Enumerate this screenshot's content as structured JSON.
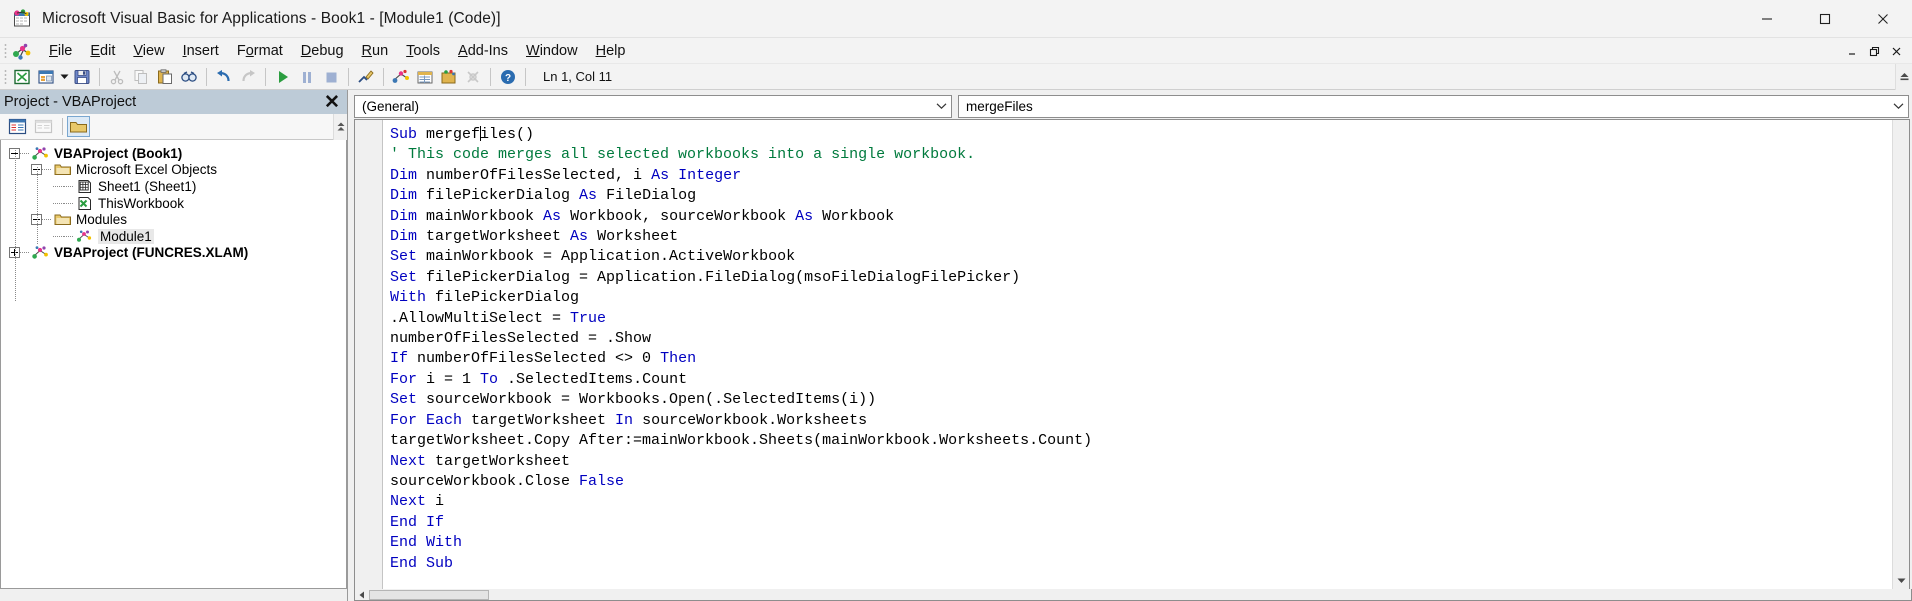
{
  "window": {
    "title": "Microsoft Visual Basic for Applications - Book1 - [Module1 (Code)]",
    "app_icon": "vba-excel-icon",
    "minimize": "—",
    "maximize": "☐",
    "close": "✕"
  },
  "mdi": {
    "minimize": "–",
    "restore": "❐",
    "close": "✕"
  },
  "menu": {
    "items": [
      {
        "label": "File",
        "accel": "F"
      },
      {
        "label": "Edit",
        "accel": "E"
      },
      {
        "label": "View",
        "accel": "V"
      },
      {
        "label": "Insert",
        "accel": "I"
      },
      {
        "label": "Format",
        "accel": "o"
      },
      {
        "label": "Debug",
        "accel": "D"
      },
      {
        "label": "Run",
        "accel": "R"
      },
      {
        "label": "Tools",
        "accel": "T"
      },
      {
        "label": "Add-Ins",
        "accel": "A"
      },
      {
        "label": "Window",
        "accel": "W"
      },
      {
        "label": "Help",
        "accel": "H"
      }
    ]
  },
  "toolbar": {
    "buttons": [
      "view-excel-icon",
      "insert-userform-icon",
      "insert-dropdown-arrow",
      "save-icon",
      "cut-icon",
      "copy-icon",
      "paste-icon",
      "find-icon",
      "undo-icon",
      "redo-icon",
      "run-icon",
      "break-icon",
      "reset-icon",
      "design-mode-icon",
      "project-explorer-icon",
      "properties-window-icon",
      "object-browser-icon",
      "toolbox-icon",
      "help-icon"
    ],
    "status_text": "Ln 1, Col 11"
  },
  "project_explorer": {
    "title": "Project - VBAProject",
    "close_label": "✕",
    "toolbar_buttons": [
      "view-code-icon",
      "view-object-icon",
      "toggle-folders-icon"
    ],
    "tree": [
      {
        "label": "VBAProject (Book1)",
        "depth": 0,
        "toggle": "minus",
        "icon": "vba-project-icon",
        "bold": true,
        "selected": false
      },
      {
        "label": "Microsoft Excel Objects",
        "depth": 1,
        "toggle": "minus",
        "icon": "folder-icon",
        "bold": false,
        "selected": false
      },
      {
        "label": "Sheet1 (Sheet1)",
        "depth": 2,
        "toggle": "none",
        "icon": "worksheet-icon",
        "bold": false,
        "selected": false
      },
      {
        "label": "ThisWorkbook",
        "depth": 2,
        "toggle": "none",
        "icon": "workbook-icon",
        "bold": false,
        "selected": false
      },
      {
        "label": "Modules",
        "depth": 1,
        "toggle": "minus",
        "icon": "folder-icon",
        "bold": false,
        "selected": false
      },
      {
        "label": "Module1",
        "depth": 2,
        "toggle": "none",
        "icon": "module-icon",
        "bold": false,
        "selected": true
      },
      {
        "label": "VBAProject (FUNCRES.XLAM)",
        "depth": 0,
        "toggle": "plus",
        "icon": "vba-project-icon",
        "bold": true,
        "selected": false
      }
    ]
  },
  "code_window": {
    "object_dropdown": {
      "value": "(General)",
      "caret": "⌄"
    },
    "procedure_dropdown": {
      "value": "mergeFiles",
      "caret": "⌄"
    },
    "colors": {
      "keyword": "#0000c0",
      "comment": "#007a3d",
      "text": "#000000",
      "background": "#ffffff"
    },
    "lines": [
      [
        {
          "t": "kw",
          "s": "Sub"
        },
        {
          "t": "tx",
          "s": " mergef"
        },
        {
          "t": "caret",
          "s": ""
        },
        {
          "t": "tx",
          "s": "iles()"
        }
      ],
      [
        {
          "t": "cm",
          "s": "' This code merges all selected workbooks into a single workbook."
        }
      ],
      [
        {
          "t": "kw",
          "s": "Dim"
        },
        {
          "t": "tx",
          "s": " numberOfFilesSelected, i "
        },
        {
          "t": "kw",
          "s": "As Integer"
        }
      ],
      [
        {
          "t": "kw",
          "s": "Dim"
        },
        {
          "t": "tx",
          "s": " filePickerDialog "
        },
        {
          "t": "kw",
          "s": "As"
        },
        {
          "t": "tx",
          "s": " FileDialog"
        }
      ],
      [
        {
          "t": "kw",
          "s": "Dim"
        },
        {
          "t": "tx",
          "s": " mainWorkbook "
        },
        {
          "t": "kw",
          "s": "As"
        },
        {
          "t": "tx",
          "s": " Workbook, sourceWorkbook "
        },
        {
          "t": "kw",
          "s": "As"
        },
        {
          "t": "tx",
          "s": " Workbook"
        }
      ],
      [
        {
          "t": "kw",
          "s": "Dim"
        },
        {
          "t": "tx",
          "s": " targetWorksheet "
        },
        {
          "t": "kw",
          "s": "As"
        },
        {
          "t": "tx",
          "s": " Worksheet"
        }
      ],
      [
        {
          "t": "kw",
          "s": "Set"
        },
        {
          "t": "tx",
          "s": " mainWorkbook = Application.ActiveWorkbook"
        }
      ],
      [
        {
          "t": "kw",
          "s": "Set"
        },
        {
          "t": "tx",
          "s": " filePickerDialog = Application.FileDialog(msoFileDialogFilePicker)"
        }
      ],
      [
        {
          "t": "kw",
          "s": "With"
        },
        {
          "t": "tx",
          "s": " filePickerDialog"
        }
      ],
      [
        {
          "t": "tx",
          "s": ".AllowMultiSelect = "
        },
        {
          "t": "kw",
          "s": "True"
        }
      ],
      [
        {
          "t": "tx",
          "s": "numberOfFilesSelected = .Show"
        }
      ],
      [
        {
          "t": "kw",
          "s": "If"
        },
        {
          "t": "tx",
          "s": " numberOfFilesSelected <> 0 "
        },
        {
          "t": "kw",
          "s": "Then"
        }
      ],
      [
        {
          "t": "kw",
          "s": "For"
        },
        {
          "t": "tx",
          "s": " i = 1 "
        },
        {
          "t": "kw",
          "s": "To"
        },
        {
          "t": "tx",
          "s": " .SelectedItems.Count"
        }
      ],
      [
        {
          "t": "kw",
          "s": "Set"
        },
        {
          "t": "tx",
          "s": " sourceWorkbook = Workbooks.Open(.SelectedItems(i))"
        }
      ],
      [
        {
          "t": "kw",
          "s": "For Each"
        },
        {
          "t": "tx",
          "s": " targetWorksheet "
        },
        {
          "t": "kw",
          "s": "In"
        },
        {
          "t": "tx",
          "s": " sourceWorkbook.Worksheets"
        }
      ],
      [
        {
          "t": "tx",
          "s": "targetWorksheet.Copy After:=mainWorkbook.Sheets(mainWorkbook.Worksheets.Count)"
        }
      ],
      [
        {
          "t": "kw",
          "s": "Next"
        },
        {
          "t": "tx",
          "s": " targetWorksheet"
        }
      ],
      [
        {
          "t": "tx",
          "s": "sourceWorkbook.Close "
        },
        {
          "t": "kw",
          "s": "False"
        }
      ],
      [
        {
          "t": "kw",
          "s": "Next"
        },
        {
          "t": "tx",
          "s": " i"
        }
      ],
      [
        {
          "t": "kw",
          "s": "End If"
        }
      ],
      [
        {
          "t": "kw",
          "s": "End With"
        }
      ],
      [
        {
          "t": "kw",
          "s": "End Sub"
        }
      ]
    ]
  },
  "scrollbars": {
    "up_arrow": "▲",
    "down_arrow": "▼",
    "left_arrow": "◀",
    "right_arrow": "▶"
  }
}
